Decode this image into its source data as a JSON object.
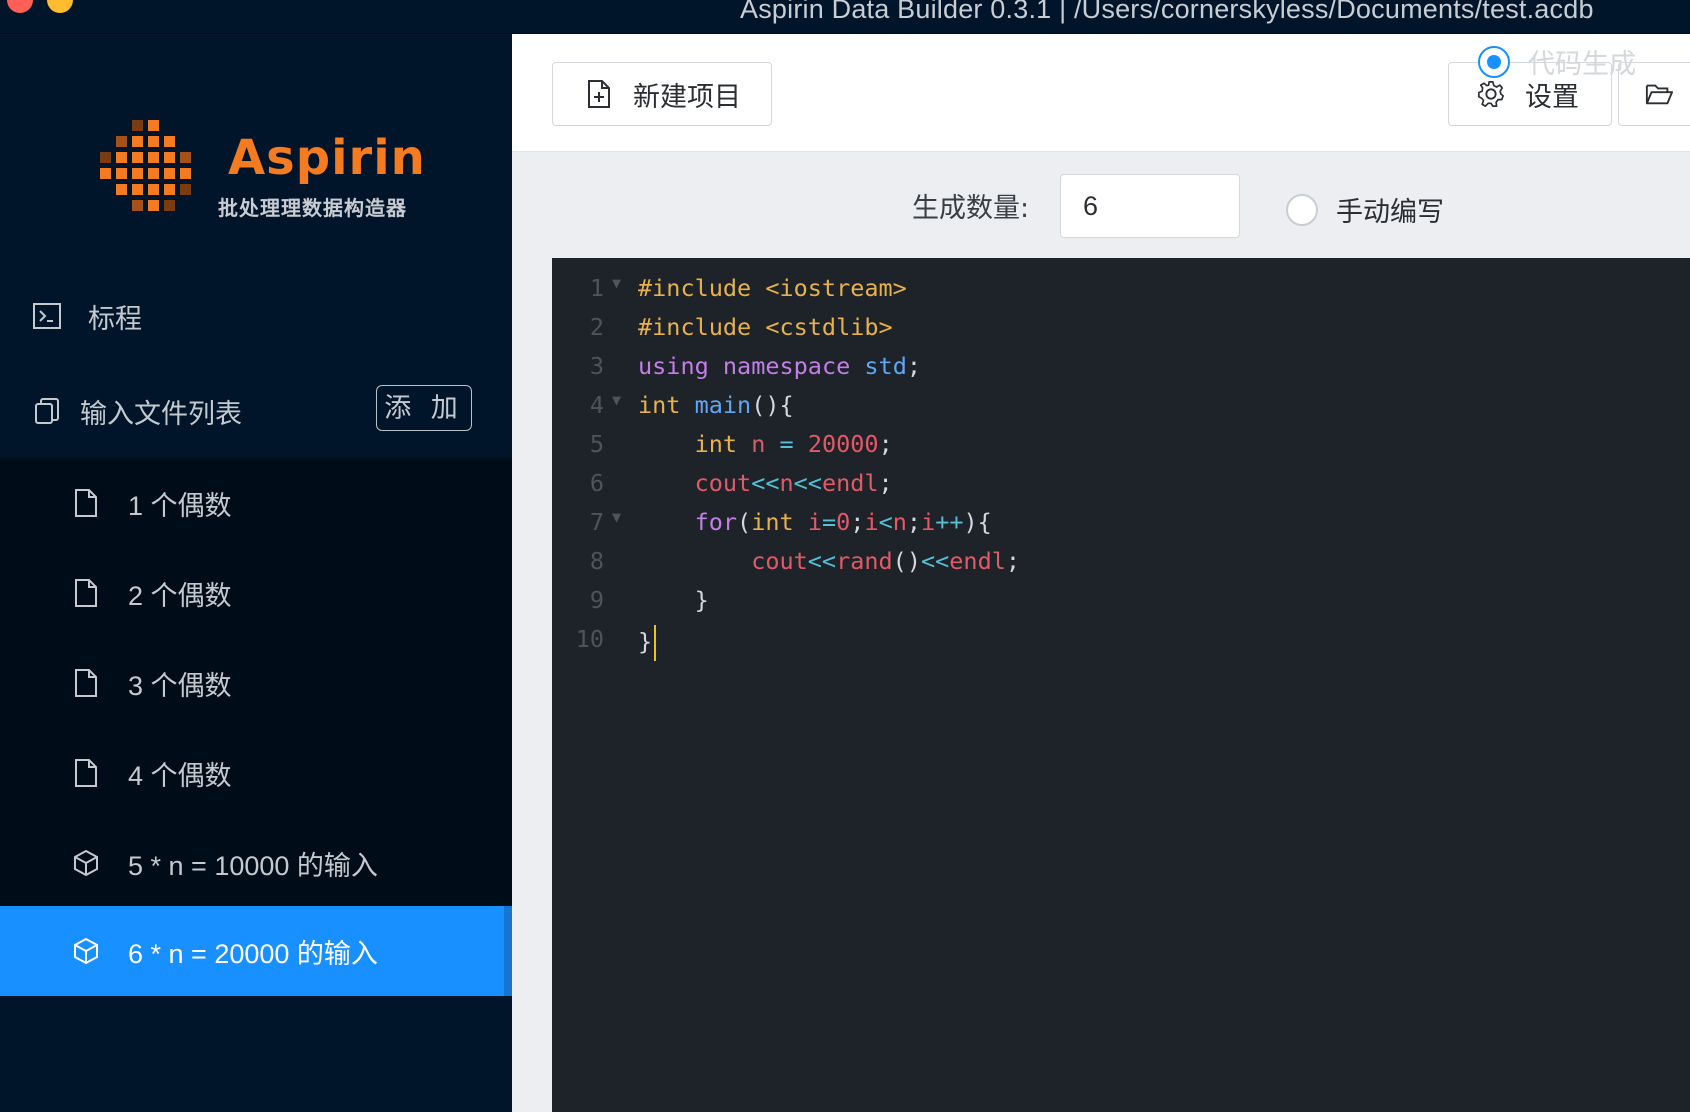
{
  "window": {
    "title": "Aspirin Data Builder 0.3.1 | /Users/cornerskyless/Documents/test.acdb"
  },
  "brand": {
    "name": "Aspirin",
    "subtitle": "批处理理数据构造器",
    "accent": "#f47b20"
  },
  "sidebar": {
    "ticket_label": "标程",
    "input_list_label": "输入文件列表",
    "add_label": "添 加",
    "items": [
      {
        "label": "1 个偶数",
        "icon": "file-icon"
      },
      {
        "label": "2 个偶数",
        "icon": "file-icon"
      },
      {
        "label": "3 个偶数",
        "icon": "file-icon"
      },
      {
        "label": "4 个偶数",
        "icon": "file-icon"
      },
      {
        "label": "5 * n = 10000 的输入",
        "icon": "cube-icon"
      },
      {
        "label": "6 * n = 20000 的输入",
        "icon": "cube-icon",
        "active": true
      }
    ],
    "active_color": "#1890ff"
  },
  "toolbar": {
    "new_project_label": "新建项目",
    "settings_label": "设置"
  },
  "generator": {
    "count_label": "生成数量:",
    "count_value": "6",
    "mode_manual_label": "手动编写",
    "mode_code_label": "代码生成",
    "selected_mode": "代码生成"
  },
  "editor": {
    "line_numbers": [
      "1",
      "2",
      "3",
      "4",
      "5",
      "6",
      "7",
      "8",
      "9",
      "10"
    ],
    "lines": [
      "#include <iostream>",
      "#include <cstdlib>",
      "using namespace std;",
      "int main(){",
      "    int n = 20000;",
      "    cout<<n<<endl;",
      "    for(int i=0;i<n;i++){",
      "        cout<<rand()<<endl;",
      "    }",
      "}"
    ]
  }
}
